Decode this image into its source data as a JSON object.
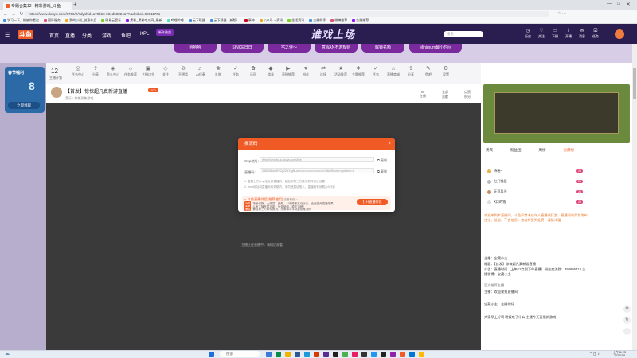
{
  "browser": {
    "tabs": [
      {
        "label": "专题合集12 | 精彩游戏_斗鱼"
      },
      {
        "label": "斗鱼"
      }
    ],
    "window_controls": [
      "—",
      "□",
      "✕"
    ],
    "url": "https://www.douyu.com/0706/0/?dyshid=a70b93-30ed5082417?&dyshci=00011701",
    "bookmarks": [
      "学习一下，把被你看过",
      "国际服务",
      "我的小说_创意作品",
      "网易云音乐",
      "黑料_黑料吃瓜网_最新",
      "哔哩哔哩",
      "云下载器",
      "云下载器（新版）",
      "原神",
      "公众号 > 资讯",
      "生活资讯",
      "主播助手",
      "微博推荐",
      "生播推荐",
      "动画实况",
      "音乐片段",
      "工具",
      "主播社区",
      "主播排行"
    ]
  },
  "header": {
    "logo_tag": "斗鱼",
    "logo_text": "",
    "nav": [
      "首页",
      "直播",
      "分类",
      "游戏",
      "鱼吧",
      "KPL"
    ],
    "promo_badge": "新年热血",
    "title": "谁戏上场",
    "search_placeholder": "搜索",
    "icons": [
      {
        "icon": "clock-icon",
        "label": "历史"
      },
      {
        "icon": "heart-icon",
        "label": "关注"
      },
      {
        "icon": "video-icon",
        "label": "下播"
      },
      {
        "icon": "upload-icon",
        "label": "开播"
      },
      {
        "icon": "mail-icon",
        "label": "消息"
      },
      {
        "icon": "task-icon",
        "label": "任务"
      },
      {
        "icon": "user-icon",
        "label": "我的"
      }
    ]
  },
  "banner_pills": [
    "哈哈哈",
    "SINCE日日",
    "宅之伴～",
    "意WAN不游规则",
    "解锁名额",
    "Minimum最小时间"
  ],
  "left_promo": {
    "title": "春节福利",
    "button": "立即领取",
    "number": "8"
  },
  "room_toolbar": {
    "count": "12",
    "count_label": "主播计划",
    "items": [
      "任务中心",
      "分享",
      "鱼丸中心",
      "任务推荐",
      "主播口令",
      "关注",
      "不想看",
      "AI伴奏",
      "礼物",
      "任务",
      "乐园",
      "道具",
      "直播推荐",
      "粉丝",
      "连接",
      "活动推荐",
      "主题推荐",
      "任务",
      "直播商城",
      "分享",
      "鱼吧",
      "设置"
    ],
    "pk_label": "PC直播间"
  },
  "room_info": {
    "title": "【首发】惊悚超凡真新游直播",
    "badge": "100",
    "id_label": "房间号",
    "subtitle": "音乐 / 惊悚恐怖游戏",
    "stats": [
      {
        "value": "90",
        "label": "在线"
      },
      {
        "value": "全部",
        "label": "贡献"
      },
      {
        "value": "点赞",
        "label": "积分"
      }
    ]
  },
  "modal": {
    "title": "推流码",
    "rtmp_label": "rtmp地址:",
    "rtmp_value": "rtmp://sendfw-a.douyu.com/live",
    "stream_label": "直播码:",
    "stream_value": "2306281eqR2Cp22Y1fgNLw••••••••••••••••••••••••••%&txSecret=spdtime=0",
    "copy_label": "复制",
    "note1": "1. 复制上方rtmp地址和直播码，粘贴到第三方推流软件对应位置",
    "note2": "2. rtmp地址和直播码有效期内，请勿泄露给他人，直播码有效期为5分钟",
    "tip_title": "斗鱼直播伴侣(推荐使用)",
    "tip_link": "查看教程 >",
    "tips": [
      {
        "tag": "功能",
        "text": "场景切换、大弹幕、美颜、AI手势等互动玩法，全面提升直播效果"
      },
      {
        "tag": "专属",
        "text": "斗鱼主播专属功能，免费使用，稳定流畅！"
      },
      {
        "tag": "兼容",
        "text": "兼容第三方软件推流，无需每次手动复制推流码"
      }
    ],
    "open_button": "打开直播伴侣"
  },
  "video_caption": "主播正在直播中，请稍后观看",
  "right_panel": {
    "tabs": [
      "贵宾",
      "粉丝团",
      "周榜",
      "贡献榜"
    ],
    "ranks": [
      {
        "name": "诗瑶~",
        "level": "26"
      },
      {
        "name": "七只猫星",
        "level": "25"
      },
      {
        "name": "天河风光",
        "level": "26"
      },
      {
        "name": "X月的钱",
        "level": "24"
      }
    ],
    "notice": "欢迎来到本直播间，斗鱼严禁未成年人直播或打赏，直播间内严禁发布违法、低俗、不良信息，违者将受到处罚，谨防诈骗",
    "chat": [
      "主播：宝藏小主",
      "标题：【首发】惊悚超凡真新游直播",
      "公告：直播时间（上午12点到下午直播）粉丝交流群：498895713 主播微博：宝藏小主",
      "官方推荐主播",
      "主播：欢迎来到直播间",
      "宝藏小主：主播你好",
      "大家早上好啊 晚饭吃了什么 主播今天直播新游戏"
    ]
  },
  "taskbar": {
    "search": "搜索",
    "time": "上午11:23",
    "date": "2024/2/8"
  }
}
